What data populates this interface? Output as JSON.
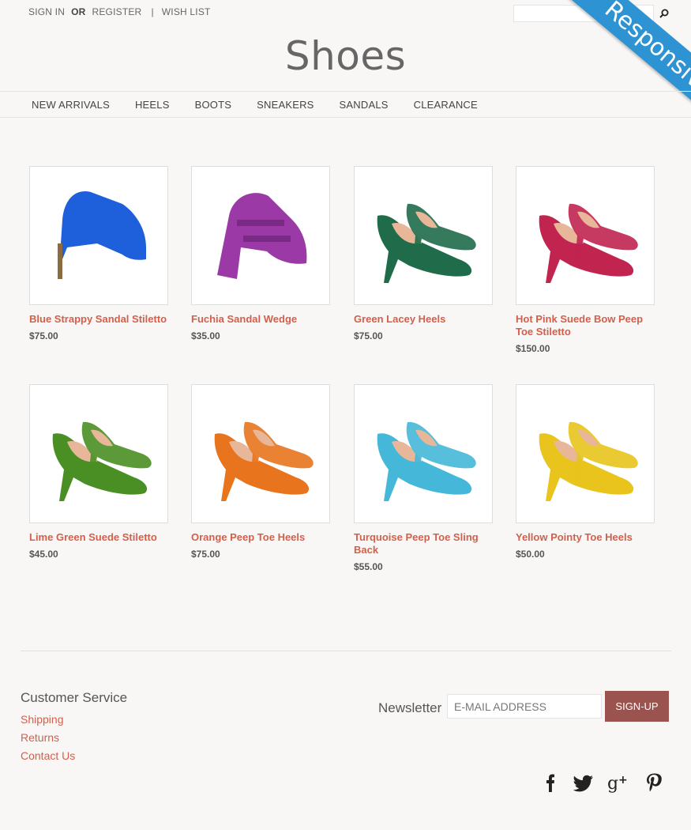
{
  "top_links": {
    "sign_in": "SIGN IN",
    "or": "OR",
    "register": "REGISTER",
    "separator": "|",
    "wish_list": "WISH LIST"
  },
  "site_title": "Shoes",
  "ribbon": "Responsive",
  "nav": [
    "NEW ARRIVALS",
    "HEELS",
    "BOOTS",
    "SNEAKERS",
    "SANDALS",
    "CLEARANCE"
  ],
  "products": [
    {
      "name": "Blue Strappy Sandal Stiletto",
      "price": "$75.00",
      "color": "#1e5fdc",
      "style": "strappy"
    },
    {
      "name": "Fuchia Sandal Wedge",
      "price": "$35.00",
      "color": "#9b3aa6",
      "style": "wedge"
    },
    {
      "name": "Green Lacey Heels",
      "price": "$75.00",
      "color": "#1f6b4a",
      "style": "pump"
    },
    {
      "name": "Hot Pink Suede Bow Peep Toe Stiletto",
      "price": "$150.00",
      "color": "#c0244f",
      "style": "pump"
    },
    {
      "name": "Lime Green Suede Stiletto",
      "price": "$45.00",
      "color": "#4a8f23",
      "style": "pump"
    },
    {
      "name": "Orange Peep Toe Heels",
      "price": "$75.00",
      "color": "#e8741e",
      "style": "pump"
    },
    {
      "name": "Turquoise Peep Toe Sling Back",
      "price": "$55.00",
      "color": "#45b7d8",
      "style": "pump"
    },
    {
      "name": "Yellow Pointy Toe Heels",
      "price": "$50.00",
      "color": "#e8c41c",
      "style": "pump"
    }
  ],
  "footer": {
    "customer_service_title": "Customer Service",
    "links": [
      "Shipping",
      "Returns",
      "Contact Us"
    ],
    "newsletter_label": "Newsletter",
    "email_placeholder": "E-MAIL ADDRESS",
    "signup_label": "SIGN-UP"
  },
  "social_icons": [
    "facebook-icon",
    "twitter-icon",
    "google-plus-icon",
    "pinterest-icon"
  ],
  "colors": {
    "accent": "#d35f4b",
    "button": "#9b5350",
    "ribbon": "#2d93d2"
  }
}
